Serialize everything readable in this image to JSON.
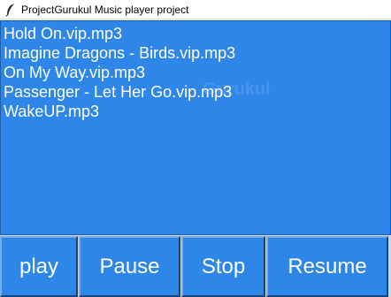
{
  "window": {
    "title": "ProjectGurukul Music player project"
  },
  "playlist": {
    "tracks": [
      "Hold On.vip.mp3",
      "Imagine Dragons - Birds.vip.mp3",
      "On My Way.vip.mp3",
      "Passenger - Let Her Go.vip.mp3",
      "WakeUP.mp3"
    ],
    "background_color": "#2e86e8"
  },
  "controls": {
    "play_label": "play",
    "pause_label": "Pause",
    "stop_label": "Stop",
    "resume_label": "Resume"
  },
  "watermark": {
    "text": "Gurukul"
  }
}
